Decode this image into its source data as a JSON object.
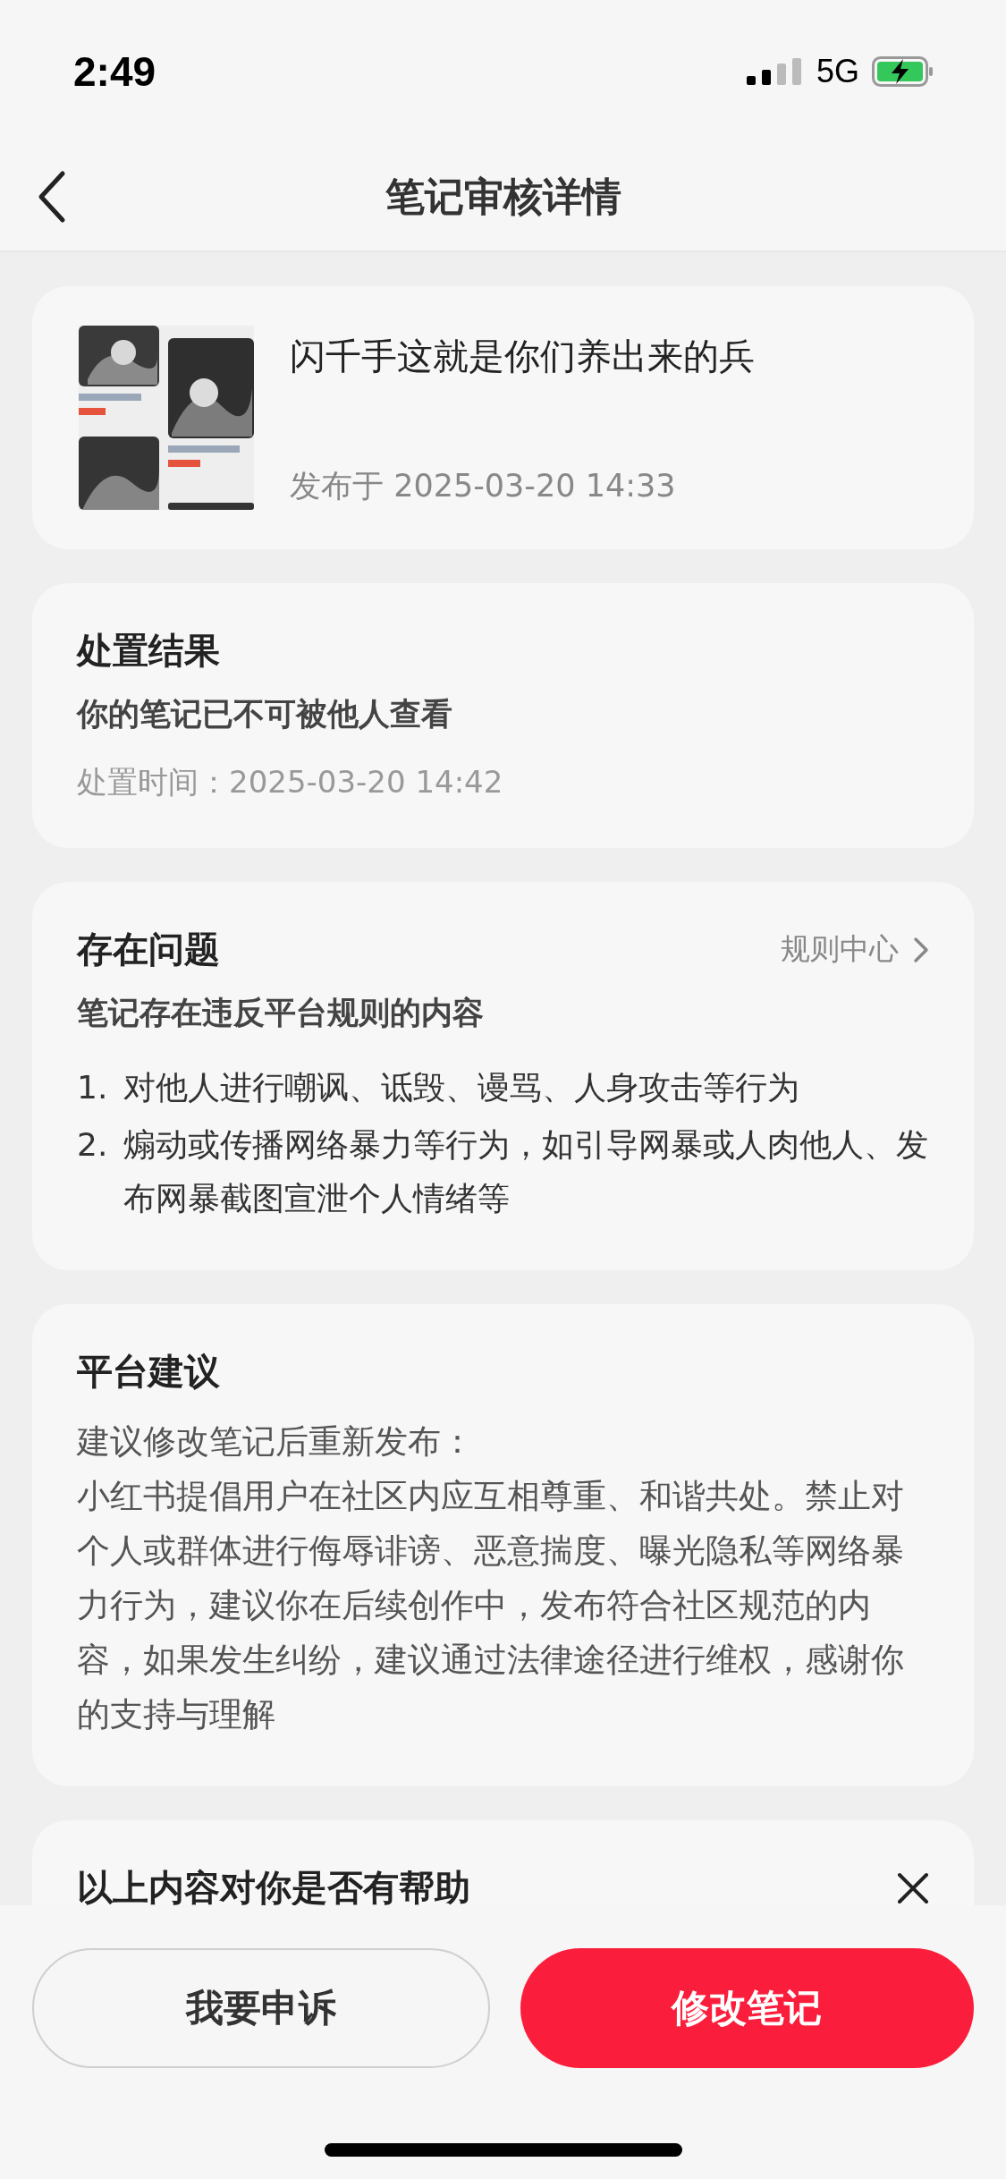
{
  "status_bar": {
    "time": "2:49",
    "network": "5G"
  },
  "nav": {
    "title": "笔记审核详情"
  },
  "note": {
    "title": "闪千手这就是你们养出来的兵",
    "published": "发布于 2025-03-20 14:33"
  },
  "sections": [
    {
      "kind": "result",
      "title": "处置结果",
      "summary": "你的笔记已不可被他人查看",
      "time": "处置时间：2025-03-20 14:42"
    },
    {
      "kind": "issues",
      "title": "存在问题",
      "link": "规则中心",
      "summary": "笔记存在违反平台规则的内容",
      "items": [
        {
          "number": "1.",
          "text": "对他人进行嘲讽、诋毁、谩骂、人身攻击等行为"
        },
        {
          "number": "2.",
          "text": "煽动或传播网络暴力等行为，如引导网暴或人肉他人、发布网暴截图宣泄个人情绪等"
        }
      ]
    },
    {
      "kind": "advice",
      "title": "平台建议",
      "lines": [
        "建议修改笔记后重新发布：",
        "小红书提倡用户在社区内应互相尊重、和谐共处。禁止对个人或群体进行侮辱诽谤、恶意揣度、曝光隐私等网络暴力行为，建议你在后续创作中，发布符合社区规范的内容，如果发生纠纷，建议通过法律途径进行维权，感谢你的支持与理解"
      ]
    },
    {
      "kind": "feedback",
      "title": "以上内容对你是否有帮助"
    }
  ],
  "buttons": [
    {
      "label": "我要申诉",
      "kind": "secondary"
    },
    {
      "label": "修改笔记",
      "kind": "primary"
    }
  ]
}
